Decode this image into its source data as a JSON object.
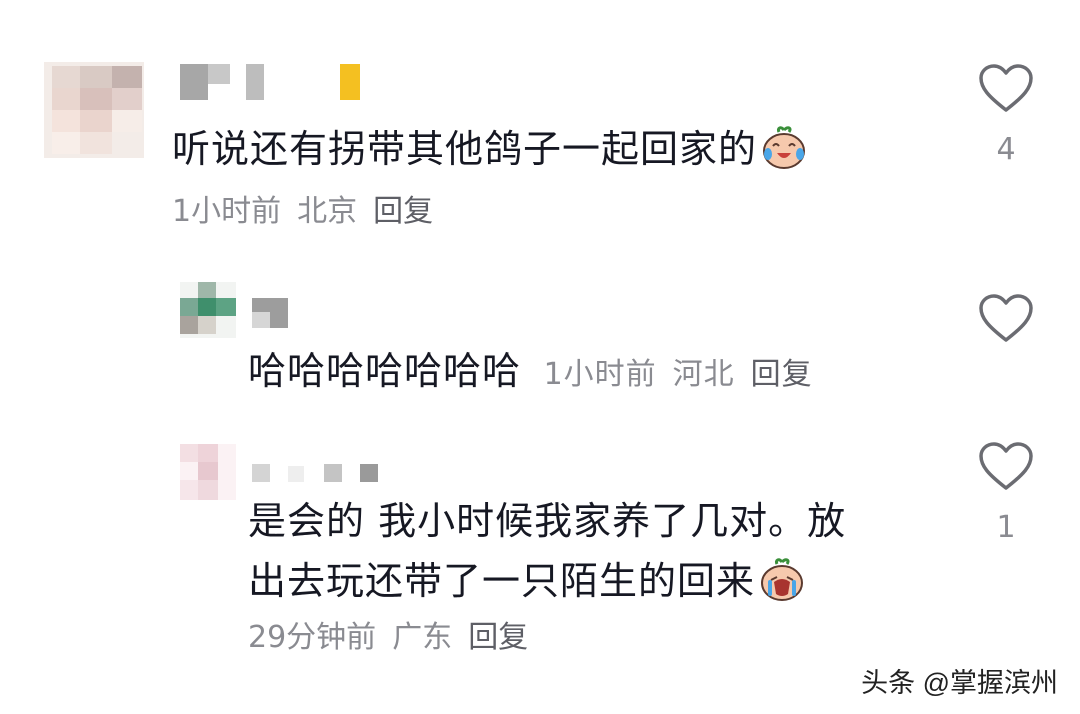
{
  "comments": [
    {
      "text": "听说还有拐带其他鸽子一起回家的",
      "emoji_icon": "crying-laughing-peach-emoji",
      "time": "1小时前",
      "location": "北京",
      "reply_label": "回复",
      "likes": "4"
    },
    {
      "text": "哈哈哈哈哈哈哈",
      "time": "1小时前",
      "location": "河北",
      "reply_label": "回复",
      "likes": ""
    },
    {
      "text_line1": "是会的 我小时候我家养了几对。放",
      "text_line2": "出去玩还带了一只陌生的回来",
      "emoji_icon": "sobbing-peach-emoji",
      "time": "29分钟前",
      "location": "广东",
      "reply_label": "回复",
      "likes": "1"
    }
  ],
  "watermark": "头条 @掌握滨州",
  "colors": {
    "text": "#161823",
    "meta": "#8a8b91",
    "heart_stroke": "#6b6c72"
  }
}
